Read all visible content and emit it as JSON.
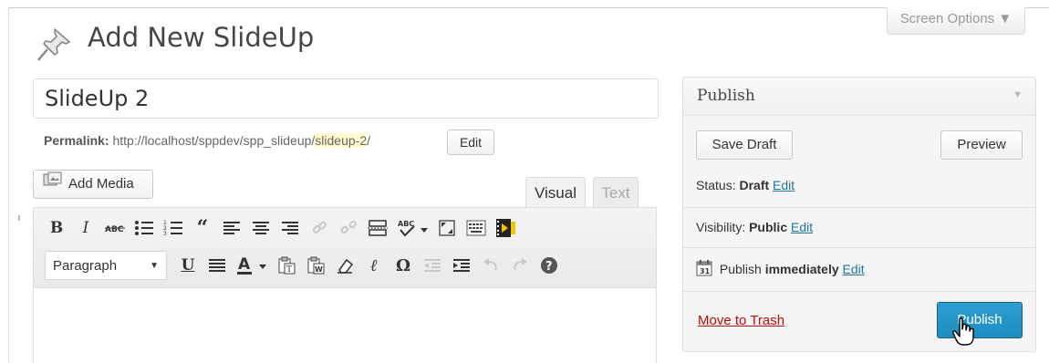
{
  "header": {
    "page_title": "Add New SlideUp",
    "screen_options": "Screen Options ▼"
  },
  "post": {
    "title_value": "SlideUp 2",
    "permalink_label": "Permalink:",
    "permalink_base": "http://localhost/sppdev/spp_slideup/",
    "permalink_slug": "slideup-2",
    "permalink_trail": "/",
    "permalink_edit": "Edit"
  },
  "editor": {
    "add_media": "Add Media",
    "tabs": [
      {
        "label": "Visual",
        "active": true
      },
      {
        "label": "Text",
        "active": false
      }
    ],
    "toolbar_row1_icons": [
      "bold-icon",
      "italic-icon",
      "strikethrough-icon",
      "bullet-list-icon",
      "numbered-list-icon",
      "blockquote-icon",
      "align-left-icon",
      "align-center-icon",
      "align-right-icon",
      "insert-link-icon",
      "unlink-icon",
      "more-tag-icon",
      "spellcheck-icon",
      "fullscreen-icon",
      "toolbar-toggle-icon",
      "media-plugin-icon"
    ],
    "format_select": "Paragraph",
    "toolbar_row2_icons": [
      "underline-icon",
      "justify-icon",
      "text-color-icon",
      "paste-text-icon",
      "paste-word-icon",
      "clear-formatting-icon",
      "special-character-icon",
      "outdent-icon",
      "indent-icon",
      "undo-icon",
      "redo-icon",
      "help-icon"
    ]
  },
  "publish": {
    "title": "Publish",
    "save_draft": "Save Draft",
    "preview": "Preview",
    "status_label": "Status:",
    "status_value": "Draft",
    "visibility_label": "Visibility:",
    "visibility_value": "Public",
    "schedule_label": "Publish",
    "schedule_value": "immediately",
    "edit_link": "Edit",
    "move_to_trash": "Move to Trash",
    "publish_button": "Publish"
  },
  "colors": {
    "accent": "#1e8cbe",
    "link": "#21759b",
    "trash": "#bc0b0b",
    "slug_highlight": "#fffbcc"
  }
}
